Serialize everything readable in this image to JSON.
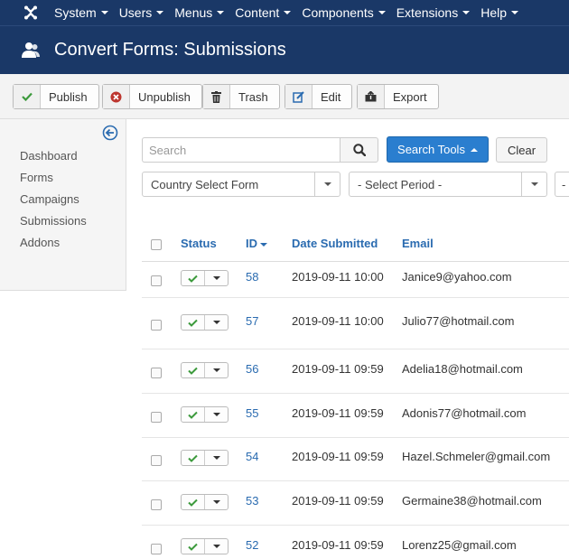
{
  "topnav": {
    "items": [
      {
        "label": "System"
      },
      {
        "label": "Users"
      },
      {
        "label": "Menus"
      },
      {
        "label": "Content"
      },
      {
        "label": "Components"
      },
      {
        "label": "Extensions"
      },
      {
        "label": "Help"
      }
    ]
  },
  "header": {
    "title": "Convert Forms: Submissions",
    "icon": "users-icon"
  },
  "toolbar": {
    "publish": "Publish",
    "unpublish": "Unpublish",
    "trash": "Trash",
    "edit": "Edit",
    "export": "Export"
  },
  "sidebar": {
    "items": [
      {
        "label": "Dashboard"
      },
      {
        "label": "Forms"
      },
      {
        "label": "Campaigns"
      },
      {
        "label": "Submissions"
      },
      {
        "label": "Addons"
      }
    ]
  },
  "search": {
    "placeholder": "Search",
    "tools_label": "Search Tools",
    "clear_label": "Clear"
  },
  "filters": {
    "form": "Country Select Form",
    "period": "- Select Period -",
    "third": "-"
  },
  "table": {
    "headers": {
      "status": "Status",
      "id": "ID",
      "date": "Date Submitted",
      "email": "Email"
    },
    "rows": [
      {
        "id": "58",
        "date": "2019-09-11 10:00",
        "email": "Janice9@yahoo.com"
      },
      {
        "id": "57",
        "date": "2019-09-11 10:00",
        "email": "Julio77@hotmail.com"
      },
      {
        "id": "56",
        "date": "2019-09-11 09:59",
        "email": "Adelia18@hotmail.com"
      },
      {
        "id": "55",
        "date": "2019-09-11 09:59",
        "email": "Adonis77@hotmail.com"
      },
      {
        "id": "54",
        "date": "2019-09-11 09:59",
        "email": "Hazel.Schmeler@gmail.com"
      },
      {
        "id": "53",
        "date": "2019-09-11 09:59",
        "email": "Germaine38@hotmail.com"
      },
      {
        "id": "52",
        "date": "2019-09-11 09:59",
        "email": "Lorenz25@gmail.com"
      }
    ]
  },
  "colors": {
    "nav_bg": "#1a3867",
    "primary_button": "#2a7ecf",
    "link": "#2a6bb0",
    "published_check": "#3c9a3c"
  }
}
